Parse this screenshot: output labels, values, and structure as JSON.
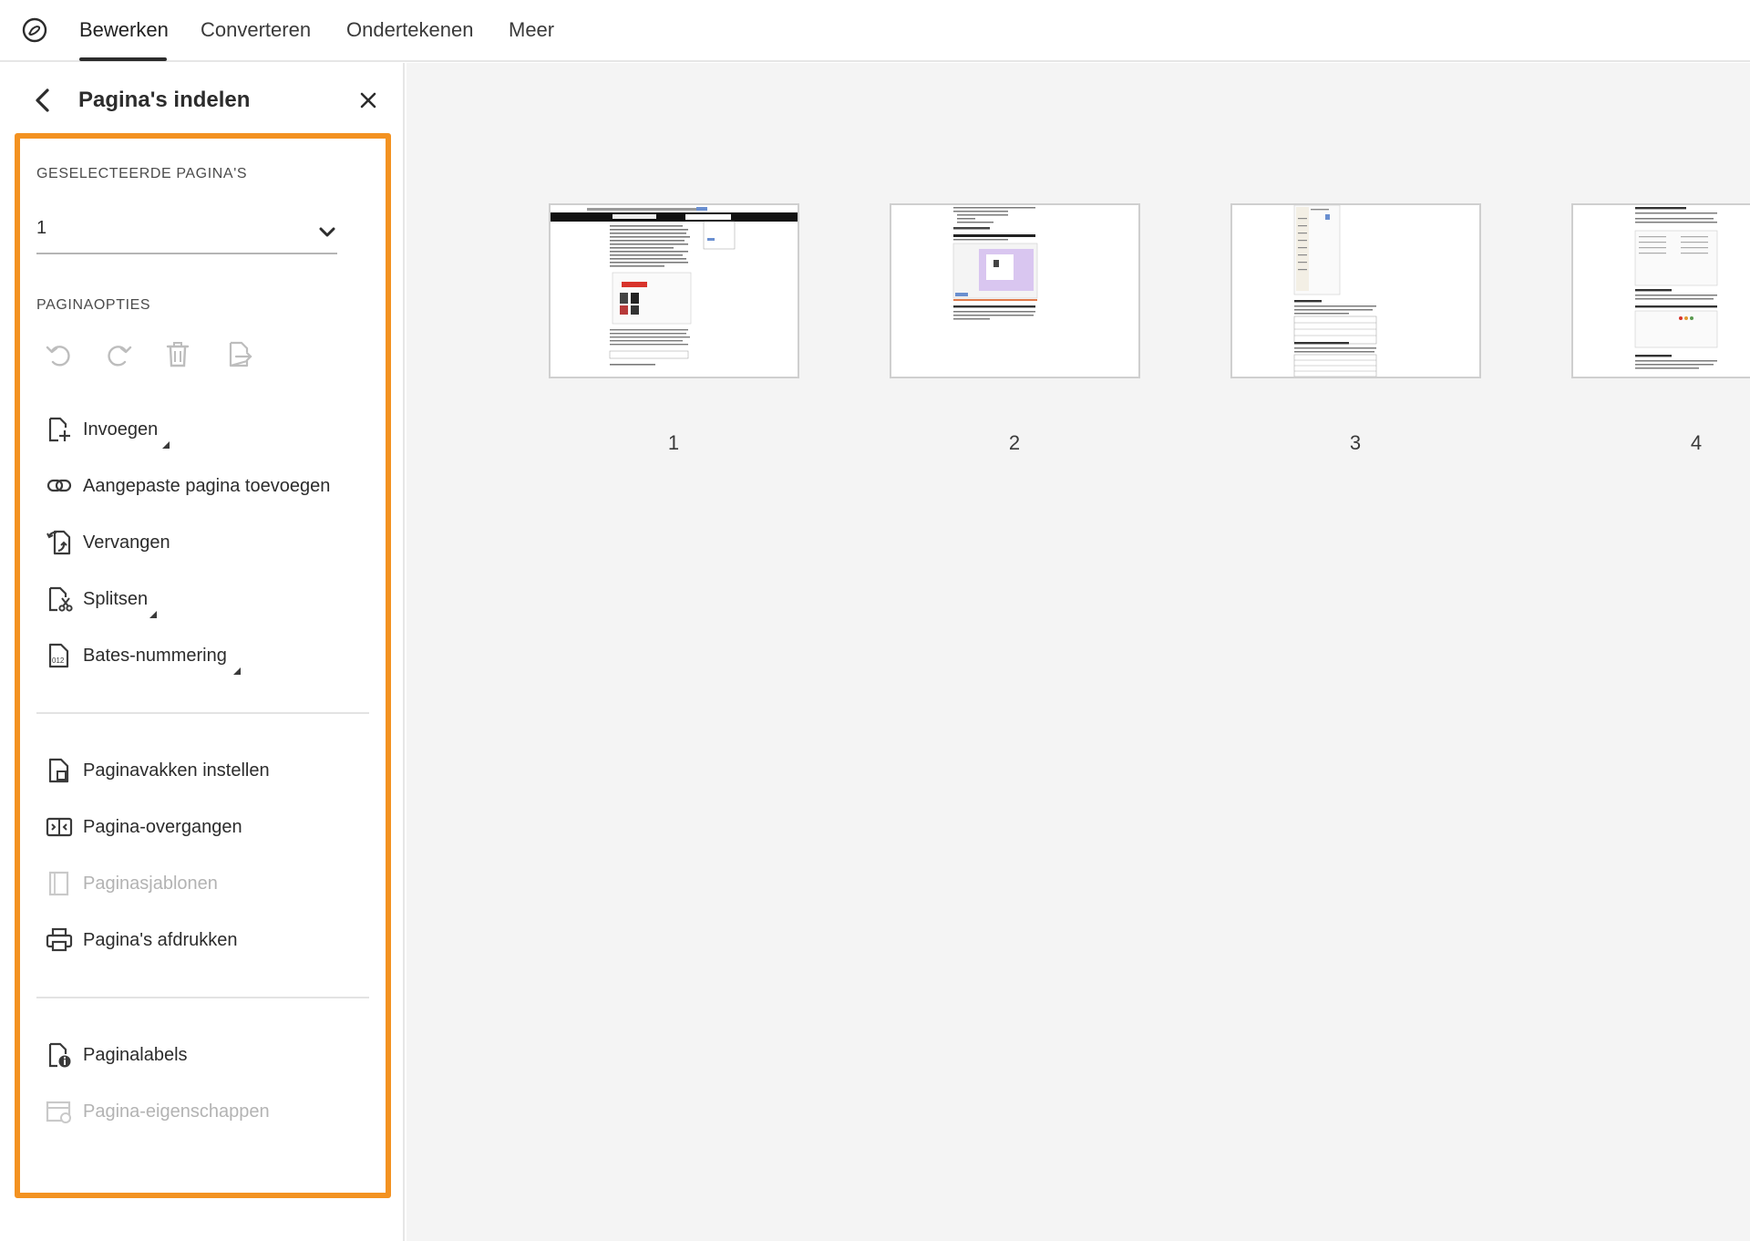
{
  "nav": {
    "app_icon": "acrobat-logo-icon",
    "tabs": [
      {
        "label": "Bewerken",
        "active": true
      },
      {
        "label": "Converteren",
        "active": false
      },
      {
        "label": "Ondertekenen",
        "active": false
      },
      {
        "label": "Meer",
        "active": false
      }
    ]
  },
  "panel": {
    "title": "Pagina's indelen",
    "back_icon": "chevron-left-icon",
    "close_icon": "close-icon",
    "highlight_color": "#f39221",
    "selected_pages_label": "GESELECTEERDE PAGINA'S",
    "selected_pages_value": "1",
    "page_options_label": "PAGINAOPTIES",
    "option_icons": [
      "undo-icon",
      "redo-icon",
      "trash-icon",
      "extract-page-icon"
    ],
    "items": [
      {
        "label": "Invoegen",
        "icon": "insert-page-icon",
        "has_submenu": true,
        "disabled": false
      },
      {
        "label": "Aangepaste pagina toevoegen",
        "icon": "link-page-icon",
        "has_submenu": false,
        "disabled": false
      },
      {
        "label": "Vervangen",
        "icon": "replace-page-icon",
        "has_submenu": false,
        "disabled": false
      },
      {
        "label": "Splitsen",
        "icon": "split-page-icon",
        "has_submenu": true,
        "disabled": false
      },
      {
        "label": "Bates-nummering",
        "icon": "bates-numbering-icon",
        "has_submenu": true,
        "disabled": false
      },
      {
        "label": "Paginavakken instellen",
        "icon": "page-boxes-icon",
        "has_submenu": false,
        "disabled": false
      },
      {
        "label": "Pagina-overgangen",
        "icon": "page-transitions-icon",
        "has_submenu": false,
        "disabled": false
      },
      {
        "label": "Paginasjablonen",
        "icon": "page-templates-icon",
        "has_submenu": false,
        "disabled": true
      },
      {
        "label": "Pagina's afdrukken",
        "icon": "printer-icon",
        "has_submenu": false,
        "disabled": false
      },
      {
        "label": "Paginalabels",
        "icon": "page-labels-icon",
        "has_submenu": false,
        "disabled": false
      },
      {
        "label": "Pagina-eigenschappen",
        "icon": "page-properties-icon",
        "has_submenu": false,
        "disabled": true
      }
    ]
  },
  "pages": [
    {
      "number": "1"
    },
    {
      "number": "2"
    },
    {
      "number": "3"
    },
    {
      "number": "4"
    }
  ]
}
